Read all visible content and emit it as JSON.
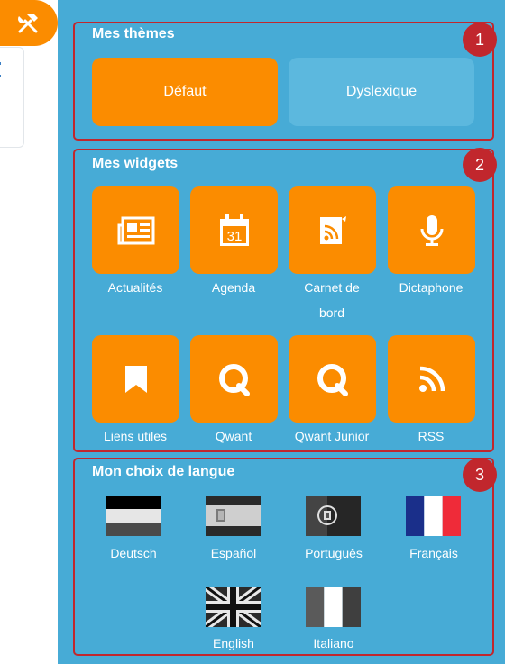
{
  "themes": {
    "title": "Mes thèmes",
    "badge": "1",
    "items": [
      {
        "label": "Défaut",
        "selected": true
      },
      {
        "label": "Dyslexique",
        "selected": false
      }
    ]
  },
  "widgets": {
    "title": "Mes widgets",
    "badge": "2",
    "items": [
      {
        "label": "Actualités",
        "icon": "newspaper-icon"
      },
      {
        "label": "Agenda",
        "icon": "calendar-icon",
        "icon_text": "31"
      },
      {
        "label_line1": "Carnet de",
        "label_line2": "bord",
        "icon": "notebook-rss-icon"
      },
      {
        "label": "Dictaphone",
        "icon": "microphone-icon"
      },
      {
        "label": "Liens utiles",
        "icon": "bookmark-icon"
      },
      {
        "label": "Qwant",
        "icon": "qwant-icon"
      },
      {
        "label": "Qwant Junior",
        "icon": "qwant-icon"
      },
      {
        "label": "RSS",
        "icon": "rss-icon"
      }
    ]
  },
  "languages": {
    "title": "Mon choix de langue",
    "badge": "3",
    "items": [
      {
        "label": "Deutsch",
        "flag": "german-flag-icon"
      },
      {
        "label": "Español",
        "flag": "spanish-flag-icon"
      },
      {
        "label": "Português",
        "flag": "portuguese-flag-icon"
      },
      {
        "label": "Français",
        "flag": "french-flag-icon"
      },
      {
        "label": "English",
        "flag": "uk-flag-icon"
      },
      {
        "label": "Italiano",
        "flag": "italian-flag-icon"
      }
    ]
  },
  "colors": {
    "panel": "#47abd6",
    "accent": "#fb8c00",
    "annotation": "#c1272d",
    "inactive_button": "#5cb8de"
  }
}
